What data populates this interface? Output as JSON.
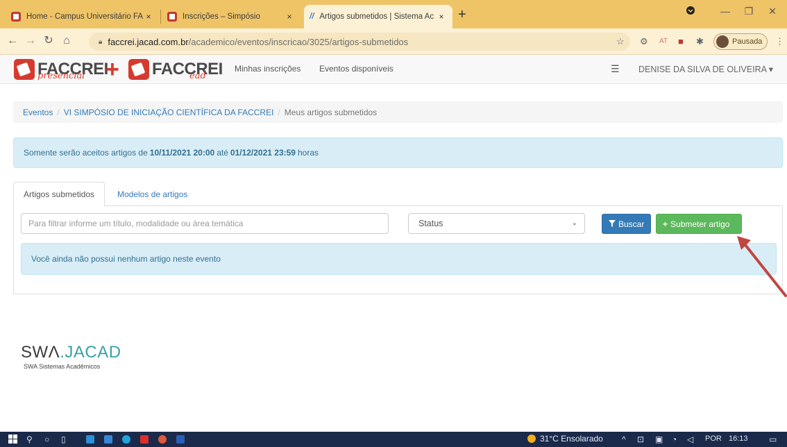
{
  "browser": {
    "tabs": [
      {
        "title": "Home - Campus Universitário FA",
        "active": false
      },
      {
        "title": "Inscrições – Simpósio",
        "active": false
      },
      {
        "title": "Artigos submetidos | Sistema Ac",
        "active": true
      }
    ],
    "new_tab": "+",
    "close": "×",
    "url_host": "faccrei.jacad.com.br",
    "url_path": "/academico/eventos/inscricao/3025/artigos-submetidos",
    "profile_label": "Pausada",
    "ext_at": "AT"
  },
  "header": {
    "logo1_word": "FACCREI",
    "logo1_script": "presencial",
    "logo_plus": "+",
    "logo2_word": "FACCREI",
    "logo2_script": "ead",
    "nav": [
      "Minhas inscrições",
      "Eventos disponíveis"
    ],
    "user": "DENISE DA SILVA DE OLIVEIRA ▾"
  },
  "breadcrumb": {
    "items": [
      "Eventos",
      "VI SIMPÓSIO DE INICIAÇÃO CIENTÍFICA DA FACCREI"
    ],
    "current": "Meus artigos submetidos",
    "separator": "/"
  },
  "alert": {
    "prefix": "Somente serão aceitos artigos de",
    "start": "10/11/2021 20:00",
    "middle": "até",
    "end": "01/12/2021 23:59",
    "suffix": "horas"
  },
  "tabs": {
    "active": "Artigos submetidos",
    "other": "Modelos de artigos"
  },
  "filter": {
    "placeholder": "Para filtrar informe um título, modalidade ou área temática",
    "status_value": "Status"
  },
  "buttons": {
    "buscar": "Buscar",
    "submeter": "Submeter artigo"
  },
  "empty_message": "Você ainda não possui nenhum artigo neste evento",
  "footer": {
    "swa_a": "SW",
    "swa_b": "Λ",
    "swa_c": ".JACAD",
    "sub": "SWA Sistemas Acadêmicos"
  },
  "taskbar": {
    "weather": "31°C Ensolarado",
    "lang": "POR",
    "time": "16:13"
  },
  "colors": {
    "primary": "#337ab7",
    "success": "#5cb85c",
    "info_bg": "#d9edf7",
    "brand_red": "#d63a2f",
    "arrow": "#c0463f"
  }
}
